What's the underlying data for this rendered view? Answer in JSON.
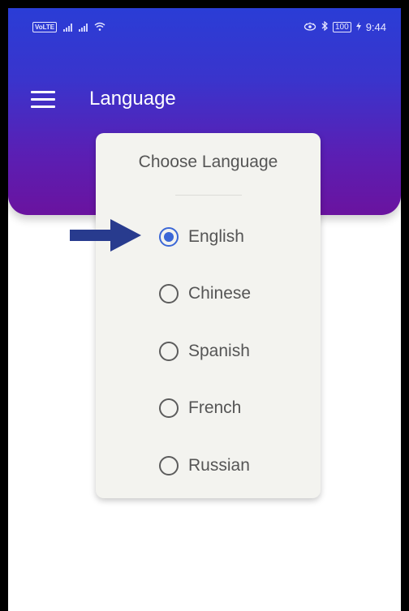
{
  "status_bar": {
    "volte_label": "VoLTE",
    "battery": "100",
    "time": "9:44",
    "icons": [
      "signal-icon",
      "wifi-icon",
      "eye-icon",
      "bluetooth-icon",
      "battery-icon",
      "charging-icon"
    ]
  },
  "toolbar": {
    "menu_icon": "hamburger-menu-icon",
    "title": "Language"
  },
  "dialog": {
    "title": "Choose Language",
    "options": [
      {
        "label": "English",
        "checked": true
      },
      {
        "label": "Chinese",
        "checked": false
      },
      {
        "label": "Spanish",
        "checked": false
      },
      {
        "label": "French",
        "checked": false
      },
      {
        "label": "Russian",
        "checked": false
      }
    ]
  },
  "annotation": {
    "icon": "arrow-right-icon"
  },
  "colors": {
    "header_top": "#2a3dd6",
    "header_bottom": "#6a139f",
    "radio_accent": "#3b67d6",
    "arrow": "#283b8e"
  }
}
